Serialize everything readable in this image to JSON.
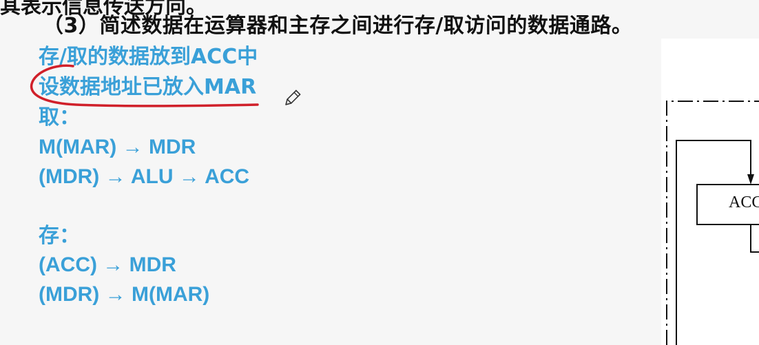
{
  "slide": {
    "top_line": "其表示信息传送方向。",
    "question": "（3）简述数据在运算器和主存之间进行存/取访问的数据通路。",
    "answer": {
      "line1": "存/取的数据放到ACC中",
      "line2": "设数据地址已放入MAR",
      "fetch_heading": "取：",
      "fetch_step1": "M(MAR) → MDR",
      "fetch_step2": "(MDR) → ALU → ACC",
      "store_heading": "存：",
      "store_step1": "(ACC) → MDR",
      "store_step2": "(MDR) → M(MAR)"
    },
    "diagram": {
      "acc_label": "ACC"
    },
    "colors": {
      "answer_text": "#3aa0d8",
      "annotation": "#d0202a"
    },
    "annotation_icon": "pencil-icon"
  }
}
